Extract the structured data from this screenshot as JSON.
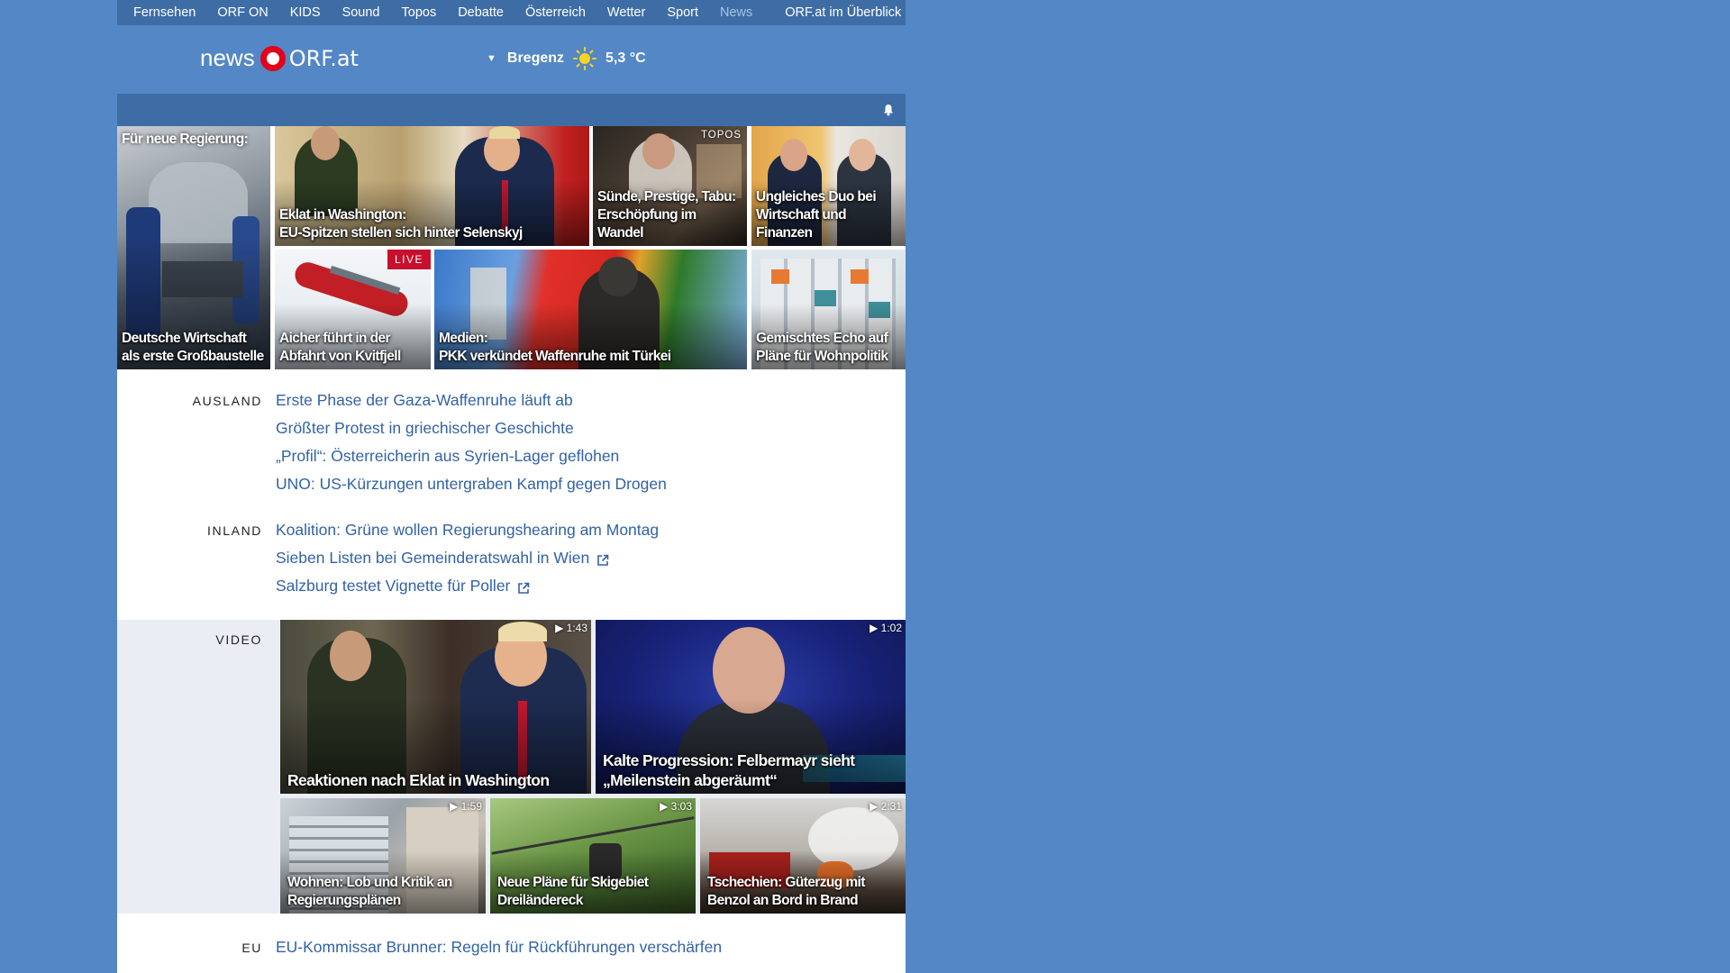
{
  "topnav": [
    "Fernsehen",
    "ORF ON",
    "KIDS",
    "Sound",
    "Topos",
    "Debatte",
    "Österreich",
    "Wetter",
    "Sport",
    "News",
    "ORF.at im Überblick"
  ],
  "logo": {
    "news": "news",
    "orf": "ORF.at"
  },
  "weather": {
    "caret": "▼",
    "city": "Bregenz",
    "temp": "5,3 °C"
  },
  "tiles": {
    "t1": {
      "top": "Für neue Regierung:",
      "caption": "Deutsche Wirtschaft\nals erste Großbaustelle"
    },
    "t2": {
      "caption": "Eklat in Washington:\nEU-Spitzen stellen sich hinter Selenskyj"
    },
    "t3": {
      "tag": "TOPOS",
      "caption": "Sünde, Prestige, Tabu:\nErschöpfung im Wandel"
    },
    "t4": {
      "caption": "Ungleiches Duo bei\nWirtschaft und Finanzen"
    },
    "t5": {
      "live": "LIVE",
      "caption": "Aicher führt in der\nAbfahrt von Kvitfjell"
    },
    "t6": {
      "caption": "Medien:\nPKK verkündet Waffenruhe mit Türkei"
    },
    "t7": {
      "caption": "Gemischtes Echo auf\nPläne für Wohnpolitik"
    }
  },
  "sections": {
    "ausland": {
      "label": "AUSLAND",
      "items": [
        "Erste Phase der Gaza-Waffenruhe läuft ab",
        "Größter Protest in griechischer Geschichte",
        "„Profil“: Österreicherin aus Syrien-Lager geflohen",
        "UNO: US-Kürzungen untergraben Kampf gegen Drogen"
      ]
    },
    "inland": {
      "label": "INLAND",
      "items": [
        "Koalition: Grüne wollen Regierungshearing am Montag",
        "Sieben Listen bei Gemeinderatswahl in Wien",
        "Salzburg testet Vignette für Poller"
      ]
    },
    "video": {
      "label": "VIDEO"
    },
    "eu": {
      "label": "EU",
      "items": [
        "EU-Kommissar Brunner: Regeln für Rückführungen verschärfen"
      ]
    }
  },
  "videos": {
    "v1": {
      "dur": "1:43",
      "caption": "Reaktionen nach Eklat in Washington"
    },
    "v2": {
      "dur": "1:02",
      "caption": "Kalte Progression: Felbermayr sieht\n„Meilenstein abgeräumt“"
    },
    "v3": {
      "dur": "1:59",
      "caption": "Wohnen: Lob und Kritik an\nRegierungsplänen"
    },
    "v4": {
      "dur": "3:03",
      "caption": "Neue Pläne für Skigebiet\nDreiländereck"
    },
    "v5": {
      "dur": "2:31",
      "caption": "Tschechien: Güterzug mit\nBenzol an Bord in Brand"
    }
  },
  "colors": {
    "background": "#5387c5",
    "bar": "#3e6da6",
    "link": "#3262a6",
    "live": "#c8102e",
    "orf_red": "#e2001a"
  }
}
